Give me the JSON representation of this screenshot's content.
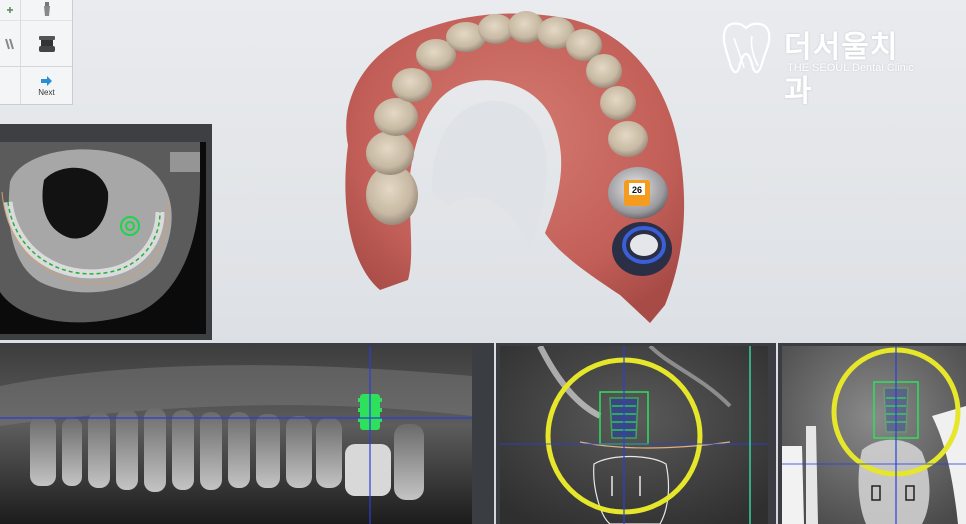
{
  "toolbar": {
    "next_label": "Next",
    "icons": [
      "implant-icon",
      "abutment-icon",
      "drill-icon",
      "cylinder-icon",
      "next-arrow-icon"
    ]
  },
  "logo": {
    "korean_text": "더서울치과",
    "english_text": "THE SEOUL Dental Clinic"
  },
  "scan": {
    "tooth_number": "26"
  },
  "colors": {
    "guide_yellow": "#e6e62a",
    "implant_green": "#31d45a",
    "reference_blue": "#2b3fd6",
    "marker_orange": "#f59b1e"
  }
}
